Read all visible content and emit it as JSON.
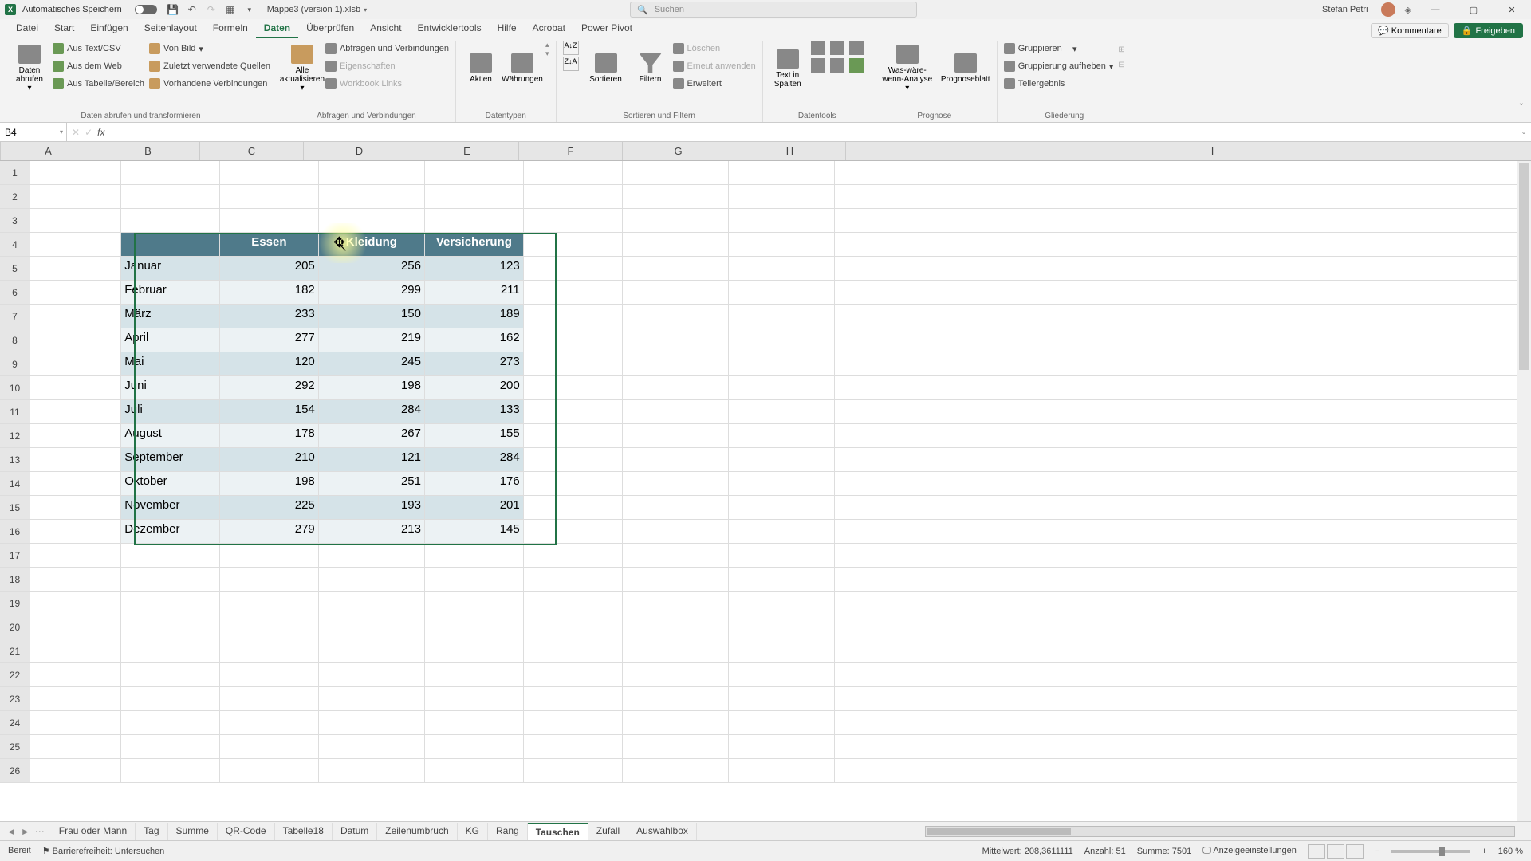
{
  "title": {
    "autosave": "Automatisches Speichern",
    "filename": "Mappe3 (version 1).xlsb",
    "search_placeholder": "Suchen",
    "user": "Stefan Petri"
  },
  "menu": {
    "tabs": [
      "Datei",
      "Start",
      "Einfügen",
      "Seitenlayout",
      "Formeln",
      "Daten",
      "Überprüfen",
      "Ansicht",
      "Entwicklertools",
      "Hilfe",
      "Acrobat",
      "Power Pivot"
    ],
    "active": "Daten",
    "kommentare": "Kommentare",
    "freigeben": "Freigeben"
  },
  "ribbon": {
    "g1": {
      "big": "Daten abrufen",
      "items": [
        "Aus Text/CSV",
        "Aus dem Web",
        "Aus Tabelle/Bereich",
        "Von Bild",
        "Zuletzt verwendete Quellen",
        "Vorhandene Verbindungen"
      ],
      "label": "Daten abrufen und transformieren"
    },
    "g2": {
      "big": "Alle aktualisieren",
      "items": [
        "Abfragen und Verbindungen",
        "Eigenschaften",
        "Workbook Links"
      ],
      "label": "Abfragen und Verbindungen"
    },
    "g3": {
      "items": [
        "Aktien",
        "Währungen"
      ],
      "label": "Datentypen"
    },
    "g4": {
      "sort": "Sortieren",
      "filter": "Filtern",
      "items": [
        "Löschen",
        "Erneut anwenden",
        "Erweitert"
      ],
      "label": "Sortieren und Filtern"
    },
    "g5": {
      "big": "Text in Spalten",
      "label": "Datentools"
    },
    "g6": {
      "items": [
        "Was-wäre-wenn-Analyse",
        "Prognoseblatt"
      ],
      "label": "Prognose"
    },
    "g7": {
      "items": [
        "Gruppieren",
        "Gruppierung aufheben",
        "Teilergebnis"
      ],
      "label": "Gliederung"
    }
  },
  "fx": {
    "name": "B4"
  },
  "cols": {
    "A": 120,
    "B": 130,
    "C": 130,
    "D": 140,
    "E": 130,
    "F": 130,
    "G": 140,
    "H": 140,
    "I": 920
  },
  "table": {
    "headers": [
      "",
      "Essen",
      "Kleidung",
      "Versicherung"
    ],
    "rows": [
      [
        "Januar",
        205,
        256,
        123
      ],
      [
        "Februar",
        182,
        299,
        211
      ],
      [
        "März",
        233,
        150,
        189
      ],
      [
        "April",
        277,
        219,
        162
      ],
      [
        "Mai",
        120,
        245,
        273
      ],
      [
        "Juni",
        292,
        198,
        200
      ],
      [
        "Juli",
        154,
        284,
        133
      ],
      [
        "August",
        178,
        267,
        155
      ],
      [
        "September",
        210,
        121,
        284
      ],
      [
        "Oktober",
        198,
        251,
        176
      ],
      [
        "November",
        225,
        193,
        201
      ],
      [
        "Dezember",
        279,
        213,
        145
      ]
    ]
  },
  "sheets": {
    "tabs": [
      "Frau oder Mann",
      "Tag",
      "Summe",
      "QR-Code",
      "Tabelle18",
      "Datum",
      "Zeilenumbruch",
      "KG",
      "Rang",
      "Tauschen",
      "Zufall",
      "Auswahlbox"
    ],
    "active": "Tauschen"
  },
  "status": {
    "ready": "Bereit",
    "access": "Barrierefreiheit: Untersuchen",
    "avg_label": "Mittelwert:",
    "avg": "208,3611111",
    "count_label": "Anzahl:",
    "count": "51",
    "sum_label": "Summe:",
    "sum": "7501",
    "display": "Anzeigeeinstellungen",
    "zoom": "160 %"
  }
}
